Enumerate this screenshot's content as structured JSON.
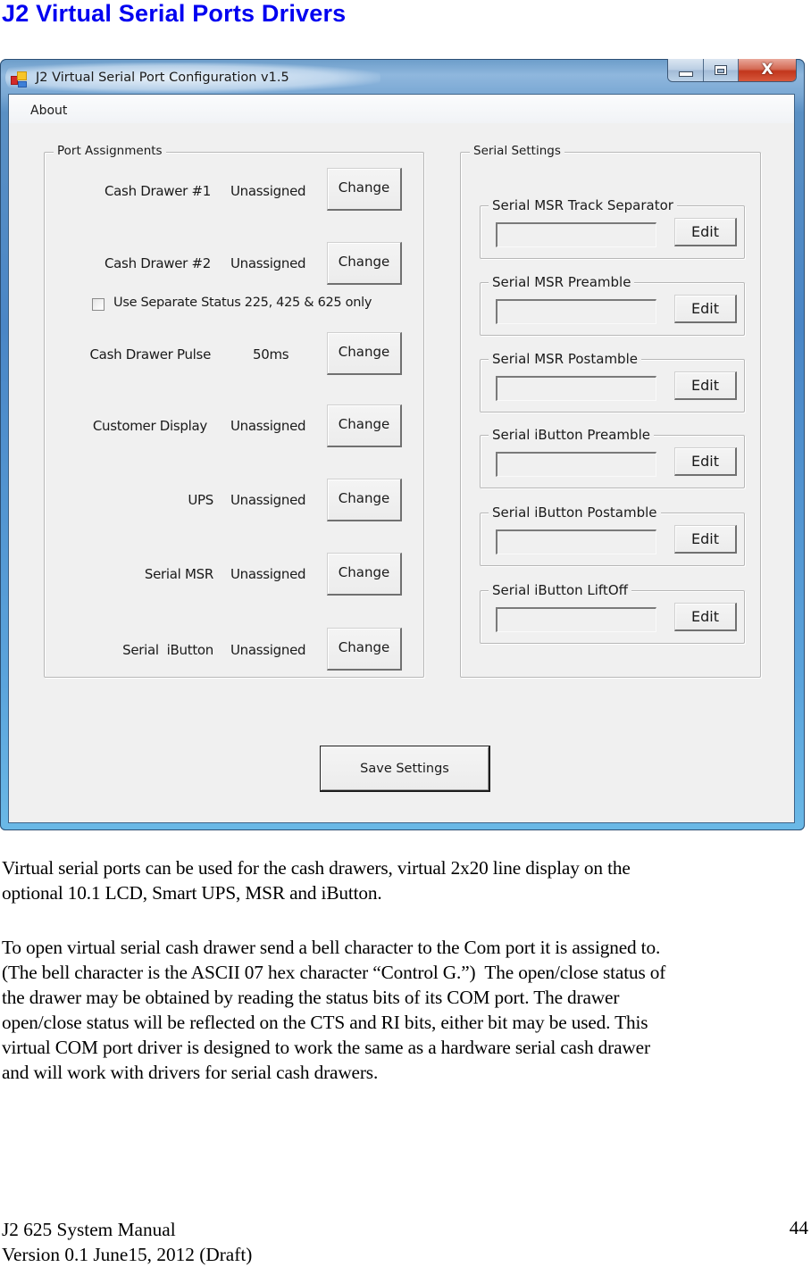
{
  "document": {
    "title": "J2 Virtual Serial Ports Drivers",
    "paragraphs": [
      {
        "lines": [
          "Virtual serial ports can be used for the cash drawers, virtual 2x20 line display on the",
          "optional 10.1 LCD, Smart UPS, MSR and iButton."
        ]
      },
      {
        "lines": [
          "To open virtual serial cash drawer send a bell character to the Com port it is assigned to.",
          "(The bell character is the ASCII 07 hex character “Control G.”)  The open/close status of",
          "the drawer may be obtained by reading the status bits of its COM port. The drawer",
          "open/close status will be reflected on the CTS and RI bits, either bit may be used. This",
          "virtual COM port driver is designed to work the same as a hardware serial cash drawer",
          "and will work with drivers for serial cash drawers."
        ]
      }
    ],
    "footer": {
      "manual": "J2 625 System Manual",
      "version": "Version 0.1 June15, 2012 (Draft)",
      "page_number": "44"
    }
  },
  "window": {
    "title": "J2 Virtual Serial Port Configuration  v1.5",
    "icon": "app-icon",
    "controls": {
      "minimize": "minimize-icon",
      "maximize": "maximize-icon",
      "close": "close-icon",
      "close_glyph": "X"
    },
    "menu": [
      "About"
    ],
    "port_assignments": {
      "legend": "Port Assignments",
      "rows": [
        {
          "label": "Cash Drawer #1",
          "value": "Unassigned",
          "button": "Change"
        },
        {
          "label": "Cash Drawer #2",
          "value": "Unassigned",
          "button": "Change"
        },
        {
          "label": "Cash Drawer Pulse",
          "value": "50ms",
          "button": "Change"
        },
        {
          "label": "Customer Display",
          "value": "Unassigned",
          "button": "Change"
        },
        {
          "label": "UPS",
          "value": "Unassigned",
          "button": "Change"
        },
        {
          "label": "Serial MSR",
          "value": "Unassigned",
          "button": "Change"
        },
        {
          "label": "Serial  iButton",
          "value": "Unassigned",
          "button": "Change"
        }
      ],
      "checkbox": {
        "label": "Use Separate Status 225, 425 & 625 only",
        "checked": false
      }
    },
    "serial_settings": {
      "legend": "Serial Settings",
      "groups": [
        {
          "legend": "Serial MSR Track Separator",
          "value": "",
          "button": "Edit"
        },
        {
          "legend": "Serial MSR Preamble",
          "value": "",
          "button": "Edit"
        },
        {
          "legend": "Serial MSR Postamble",
          "value": "",
          "button": "Edit"
        },
        {
          "legend": "Serial iButton Preamble",
          "value": "",
          "button": "Edit"
        },
        {
          "legend": "Serial iButton Postamble",
          "value": "",
          "button": "Edit"
        },
        {
          "legend": "Serial iButton LiftOff",
          "value": "",
          "button": "Edit"
        }
      ]
    },
    "save_button": "Save Settings"
  }
}
